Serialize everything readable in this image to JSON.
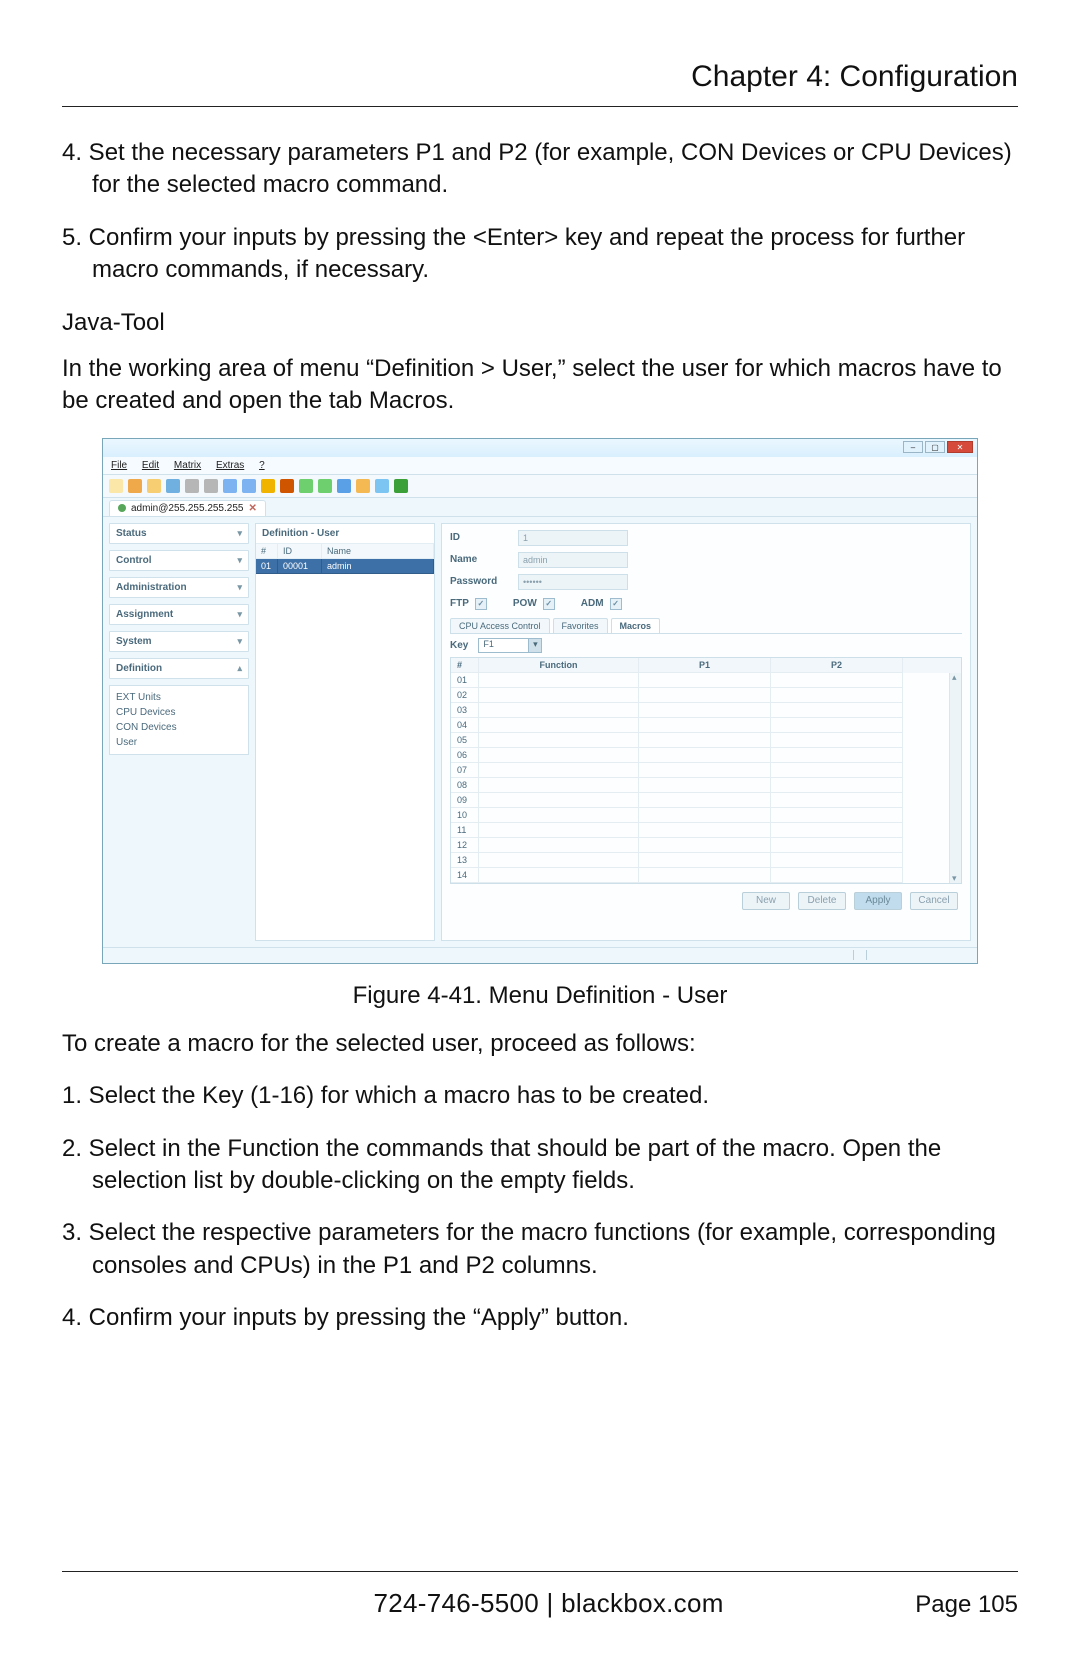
{
  "header": {
    "chapter": "Chapter 4: Configuration"
  },
  "steps_top": {
    "s4": "4. Set the necessary parameters P1 and P2 (for example, CON Devices or CPU Devices) for the selected macro command.",
    "s5": "5. Confirm your inputs by pressing the <Enter> key and repeat the process for further macro commands, if necessary."
  },
  "subhead": "Java-Tool",
  "intro": "In the working area of menu “Definition > User,” select the user for which macros have to be created and open the tab Macros.",
  "figure_caption": "Figure 4-41. Menu Definition - User",
  "post_fig": "To create a macro for the selected user, proceed as follows:",
  "steps_bottom": {
    "s1": "1. Select the Key (1-16) for which a macro has to be created.",
    "s2": "2. Select in the Function the commands that should be part of the macro. Open the selection list by double-clicking on the empty fields.",
    "s3": "3. Select the respective parameters for the macro functions (for example, corresponding consoles and CPUs) in the P1 and P2 columns.",
    "s4b": "4. Confirm your inputs by pressing the “Apply” button."
  },
  "footer": {
    "contact": "724-746-5500   |   blackbox.com",
    "page": "Page 105"
  },
  "app": {
    "menus": {
      "file": "File",
      "edit": "Edit",
      "matrix": "Matrix",
      "extras": "Extras",
      "help": "?"
    },
    "tab": {
      "label": "admin@255.255.255.255",
      "close": "✕"
    },
    "nav": {
      "status": "Status",
      "control": "Control",
      "admin": "Administration",
      "assign": "Assignment",
      "system": "System",
      "def": "Definition",
      "def_items": {
        "ext": "EXT Units",
        "cpu": "CPU Devices",
        "con": "CON Devices",
        "user": "User"
      }
    },
    "mid": {
      "title": "Definition - User",
      "hdr_num": "#",
      "hdr_id": "ID",
      "hdr_name": "Name",
      "row_num": "01",
      "row_id": "00001",
      "row_name": "admin"
    },
    "form": {
      "id_lbl": "ID",
      "id_val": "1",
      "name_lbl": "Name",
      "name_val": "admin",
      "pw_lbl": "Password",
      "pw_val": "••••••",
      "ftp": "FTP",
      "pow": "POW",
      "adm": "ADM"
    },
    "subtabs": {
      "t1": "CPU Access Control",
      "t2": "Favorites",
      "t3": "Macros"
    },
    "key_lbl": "Key",
    "key_val": "F1",
    "mtable": {
      "hdr_num": "#",
      "hdr_fn": "Function",
      "hdr_p1": "P1",
      "hdr_p2": "P2",
      "rows": [
        "01",
        "02",
        "03",
        "04",
        "05",
        "06",
        "07",
        "08",
        "09",
        "10",
        "11",
        "12",
        "13",
        "14"
      ]
    },
    "buttons": {
      "new": "New",
      "delete": "Delete",
      "apply": "Apply",
      "cancel": "Cancel"
    }
  }
}
